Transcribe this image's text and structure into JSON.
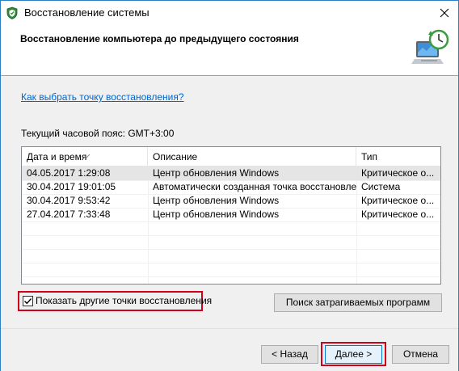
{
  "window": {
    "title": "Восстановление системы"
  },
  "header": {
    "title": "Восстановление компьютера до предыдущего состояния"
  },
  "content": {
    "help_link": "Как выбрать точку восстановления?",
    "timezone_label": "Текущий часовой пояс: GMT+3:00"
  },
  "table": {
    "columns": [
      "Дата и время",
      "Описание",
      "Тип"
    ],
    "rows": [
      {
        "date": "04.05.2017 1:29:08",
        "description": "Центр обновления Windows",
        "type": "Критическое о...",
        "selected": true
      },
      {
        "date": "30.04.2017 19:01:05",
        "description": "Автоматически созданная точка восстановле...",
        "type": "Система",
        "selected": false
      },
      {
        "date": "30.04.2017 9:53:42",
        "description": "Центр обновления Windows",
        "type": "Критическое о...",
        "selected": false
      },
      {
        "date": "27.04.2017 7:33:48",
        "description": "Центр обновления Windows",
        "type": "Критическое о...",
        "selected": false
      }
    ]
  },
  "options": {
    "show_more_label": "Показать другие точки восстановления",
    "show_more_checked": true
  },
  "buttons": {
    "search_label": "Поиск затрагиваемых программ",
    "back_label": "< Назад",
    "next_label": "Далее >",
    "cancel_label": "Отмена"
  },
  "colors": {
    "highlight": "#d0021b",
    "link": "#0066cc",
    "window_border": "#2b80c8"
  },
  "icons": {
    "title": "system-restore-shield-icon",
    "header": "restore-computer-clock-icon",
    "close": "close-icon",
    "sort": "sort-ascending-icon",
    "checkbox": "checkmark-icon"
  }
}
